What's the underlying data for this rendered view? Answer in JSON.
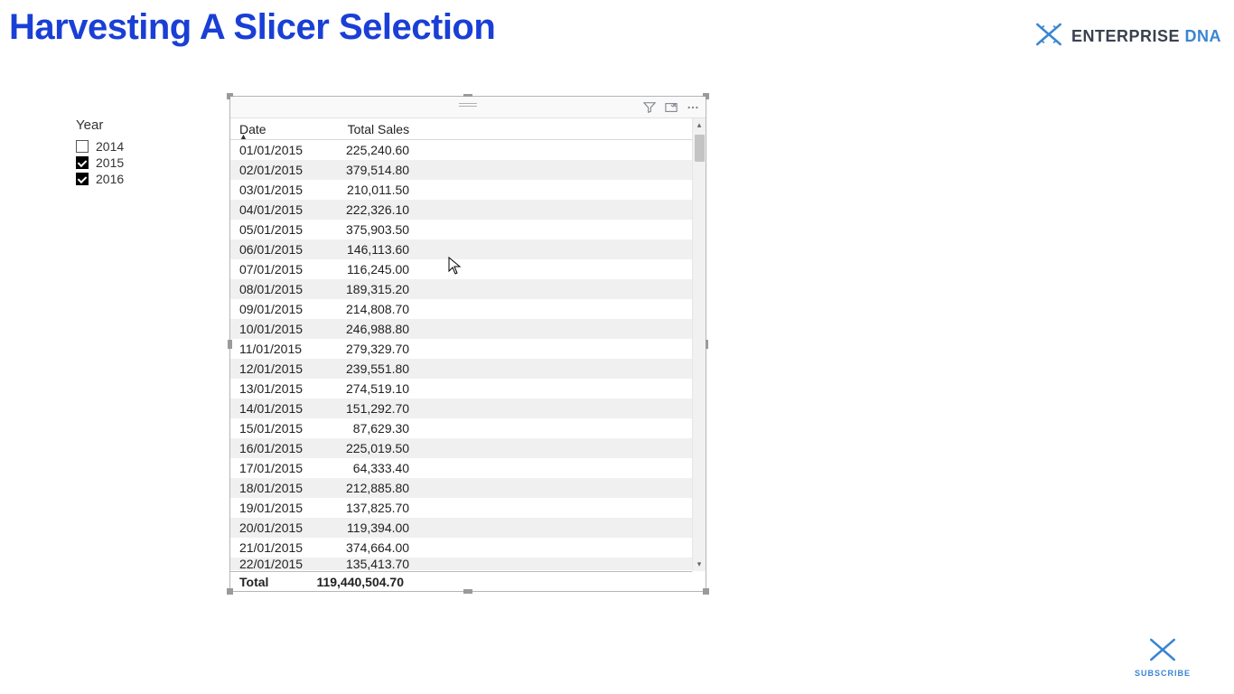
{
  "page": {
    "title": "Harvesting A Slicer Selection"
  },
  "brand": {
    "name1": "ENTERPRISE ",
    "name2": "DNA",
    "subscribe": "SUBSCRIBE"
  },
  "slicer": {
    "title": "Year",
    "items": [
      {
        "label": "2014",
        "checked": false
      },
      {
        "label": "2015",
        "checked": true
      },
      {
        "label": "2016",
        "checked": true
      }
    ]
  },
  "table": {
    "headers": {
      "date": "Date",
      "sales": "Total Sales"
    },
    "rows": [
      {
        "date": "01/01/2015",
        "sales": "225,240.60"
      },
      {
        "date": "02/01/2015",
        "sales": "379,514.80"
      },
      {
        "date": "03/01/2015",
        "sales": "210,011.50"
      },
      {
        "date": "04/01/2015",
        "sales": "222,326.10"
      },
      {
        "date": "05/01/2015",
        "sales": "375,903.50"
      },
      {
        "date": "06/01/2015",
        "sales": "146,113.60"
      },
      {
        "date": "07/01/2015",
        "sales": "116,245.00"
      },
      {
        "date": "08/01/2015",
        "sales": "189,315.20"
      },
      {
        "date": "09/01/2015",
        "sales": "214,808.70"
      },
      {
        "date": "10/01/2015",
        "sales": "246,988.80"
      },
      {
        "date": "11/01/2015",
        "sales": "279,329.70"
      },
      {
        "date": "12/01/2015",
        "sales": "239,551.80"
      },
      {
        "date": "13/01/2015",
        "sales": "274,519.10"
      },
      {
        "date": "14/01/2015",
        "sales": "151,292.70"
      },
      {
        "date": "15/01/2015",
        "sales": "87,629.30"
      },
      {
        "date": "16/01/2015",
        "sales": "225,019.50"
      },
      {
        "date": "17/01/2015",
        "sales": "64,333.40"
      },
      {
        "date": "18/01/2015",
        "sales": "212,885.80"
      },
      {
        "date": "19/01/2015",
        "sales": "137,825.70"
      },
      {
        "date": "20/01/2015",
        "sales": "119,394.00"
      },
      {
        "date": "21/01/2015",
        "sales": "374,664.00"
      },
      {
        "date": "22/01/2015",
        "sales": "135,413.70"
      }
    ],
    "total_label": "Total",
    "total_value": "119,440,504.70"
  }
}
